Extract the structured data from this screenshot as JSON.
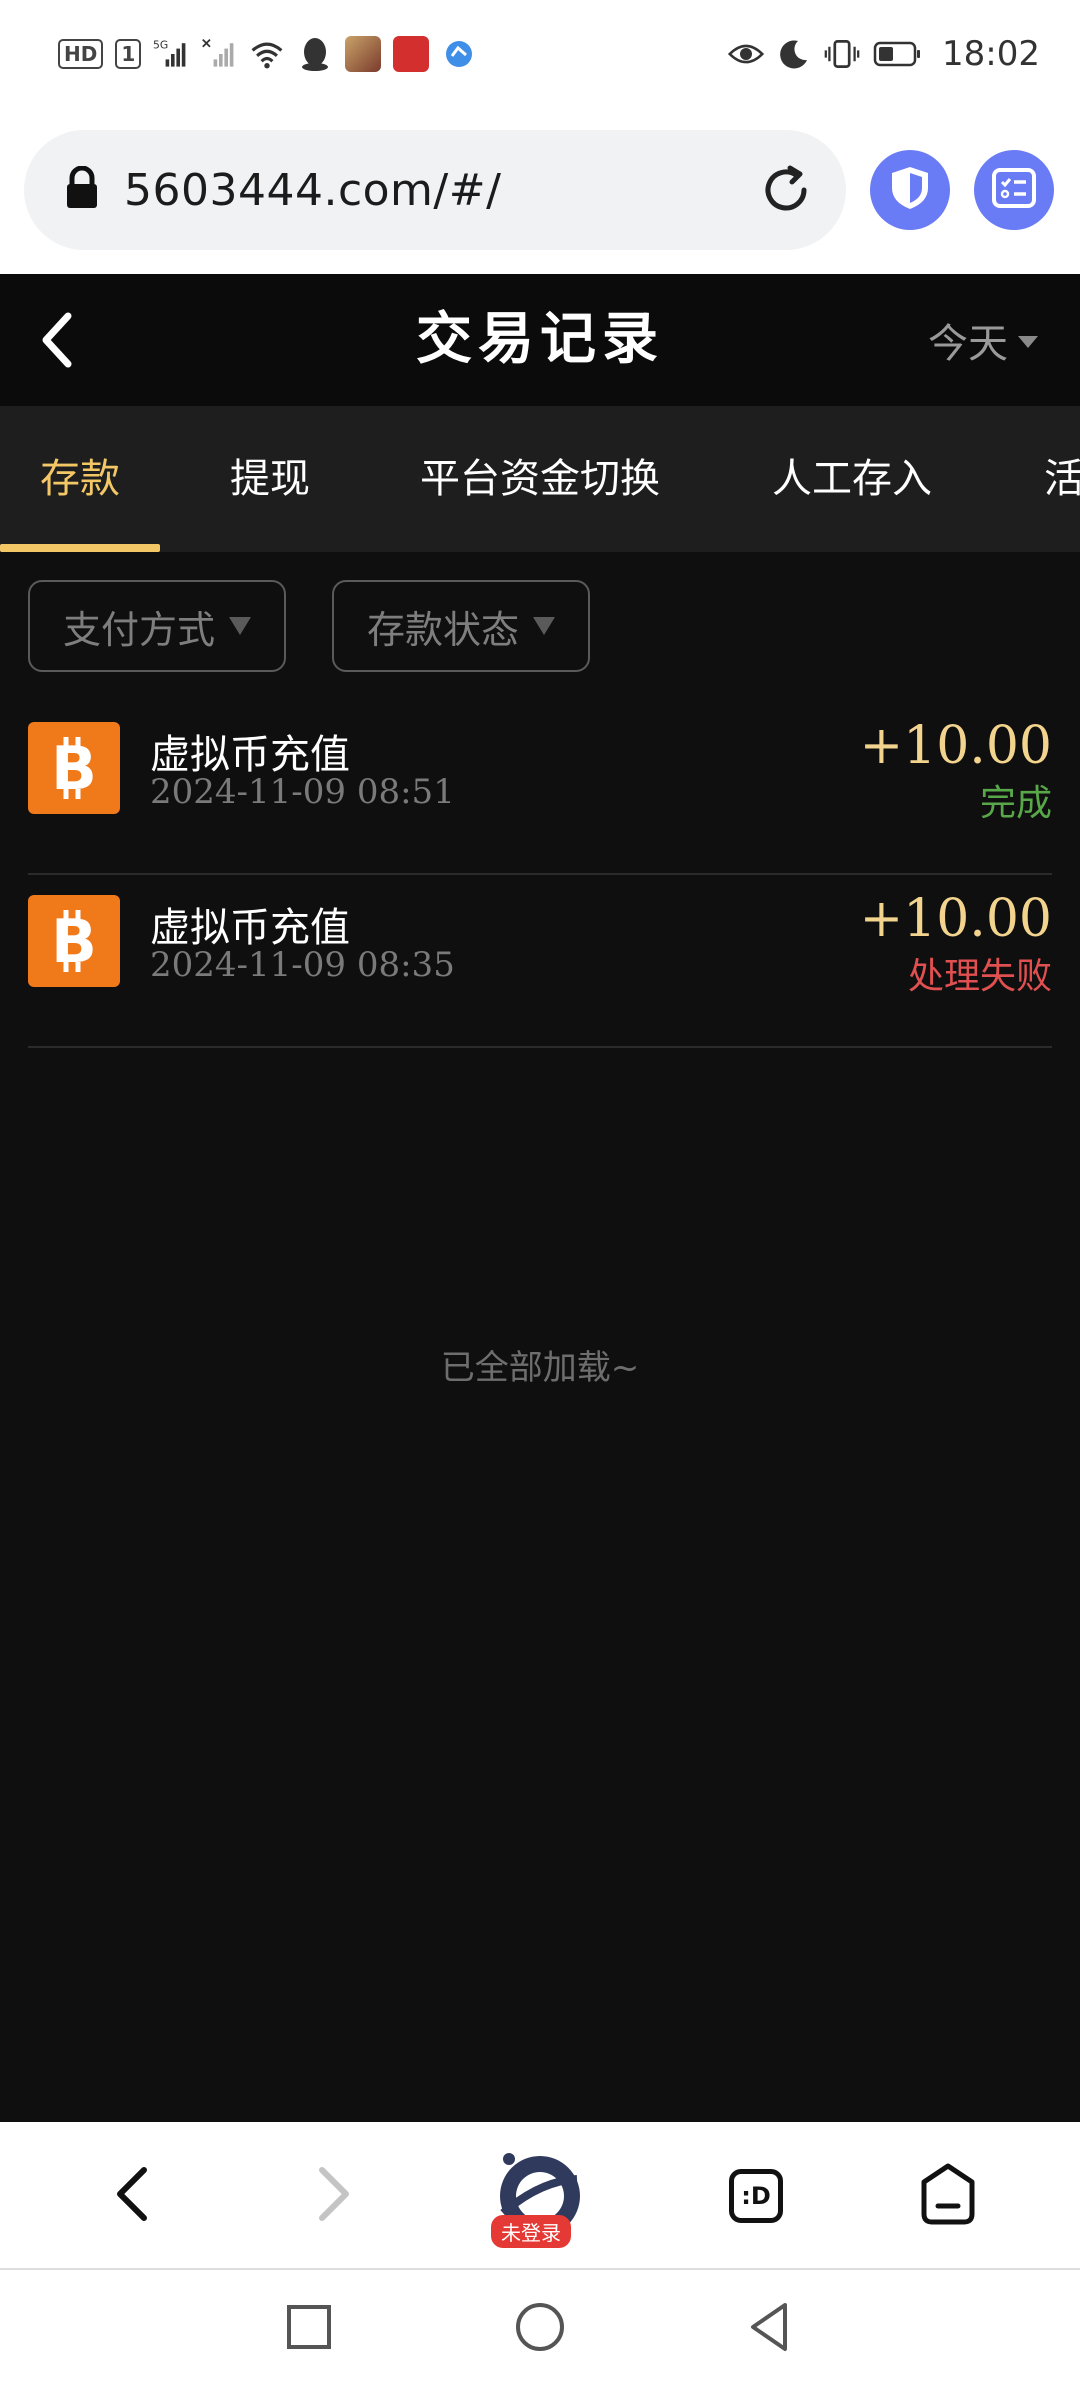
{
  "status_bar": {
    "network_badge": "HD",
    "sim_badge": "1",
    "net_type": "5G",
    "time": "18:02"
  },
  "browser": {
    "url": "5603444.com/#/",
    "icons": [
      "lock-icon",
      "reload-icon",
      "shield-icon",
      "task-list-icon"
    ]
  },
  "header": {
    "title": "交易记录",
    "date_filter": "今天"
  },
  "tabs": [
    {
      "label": "存款",
      "active": true
    },
    {
      "label": "提现",
      "active": false
    },
    {
      "label": "平台资金切换",
      "active": false
    },
    {
      "label": "人工存入",
      "active": false
    },
    {
      "label": "活",
      "active": false
    }
  ],
  "filters": {
    "payment_method": "支付方式",
    "deposit_status": "存款状态"
  },
  "records": [
    {
      "title": "虚拟币充值",
      "time": "2024-11-09 08:51",
      "amount": "+10.00",
      "status": "完成",
      "status_color": "#58a849"
    },
    {
      "title": "虚拟币充值",
      "time": "2024-11-09 08:35",
      "amount": "+10.00",
      "status": "处理失败",
      "status_color": "#e05050"
    }
  ],
  "load_all_text": "已全部加载~",
  "bottom_toolbar": {
    "login_badge": "未登录",
    "tab_button_label": ":D"
  },
  "colors": {
    "accent": "#f4c766",
    "amount": "#f3d48e",
    "btc": "#f0791a",
    "browser_button": "#6a7bf6"
  }
}
